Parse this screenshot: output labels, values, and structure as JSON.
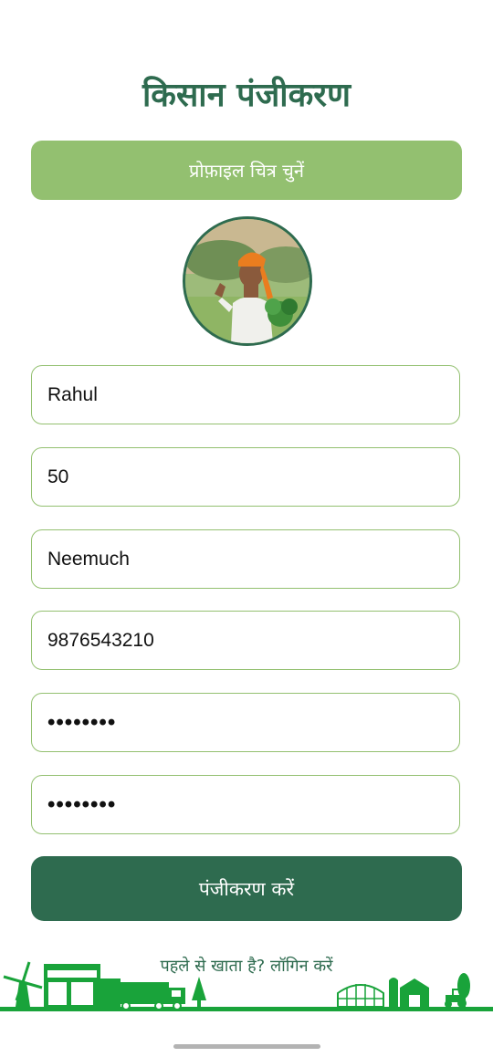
{
  "page": {
    "title": "किसान पंजीकरण"
  },
  "profile": {
    "choose_button": "प्रोफ़ाइल चित्र चुनें"
  },
  "form": {
    "name": "Rahul",
    "age": "50",
    "city": "Neemuch",
    "phone": "9876543210",
    "password": "••••••••",
    "confirm_password": "••••••••"
  },
  "actions": {
    "register_button": "पंजीकरण करें",
    "login_link": "पहले से खाता है? लॉगिन करें"
  },
  "colors": {
    "primary": "#2e6b4f",
    "accent": "#93c070",
    "scene": "#19a33a"
  }
}
